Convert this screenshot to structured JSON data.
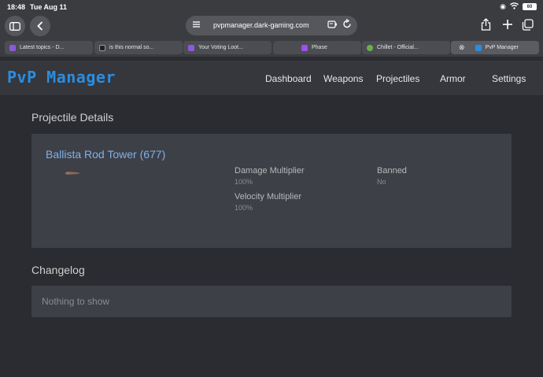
{
  "status": {
    "time": "18:48",
    "date": "Tue Aug 11",
    "battery": "60"
  },
  "browser": {
    "url": "pvpmanager.dark-gaming.com",
    "tabs": [
      {
        "label": "Latest topics - D...",
        "color": "#8a5bd6"
      },
      {
        "label": "is this normal so...",
        "color": "#222222"
      },
      {
        "label": "Your Voting Loot...",
        "color": "#8a5bd6"
      },
      {
        "label": "Phase",
        "color": "#a24df0"
      },
      {
        "label": "Chillet - Official...",
        "color": "#6ab04c"
      },
      {
        "label": "PvP Manager",
        "color": "#2b8de0"
      }
    ]
  },
  "nav": {
    "brand": "PvP Manager",
    "items": [
      "Dashboard",
      "Weapons",
      "Projectiles",
      "Armor",
      "Settings"
    ]
  },
  "details": {
    "section_title": "Projectile Details",
    "name": "Ballista Rod Tower (677)",
    "damage_label": "Damage Multiplier",
    "damage_value": "100%",
    "velocity_label": "Velocity Multiplier",
    "velocity_value": "100%",
    "banned_label": "Banned",
    "banned_value": "No"
  },
  "changelog": {
    "section_title": "Changelog",
    "empty_text": "Nothing to show"
  }
}
